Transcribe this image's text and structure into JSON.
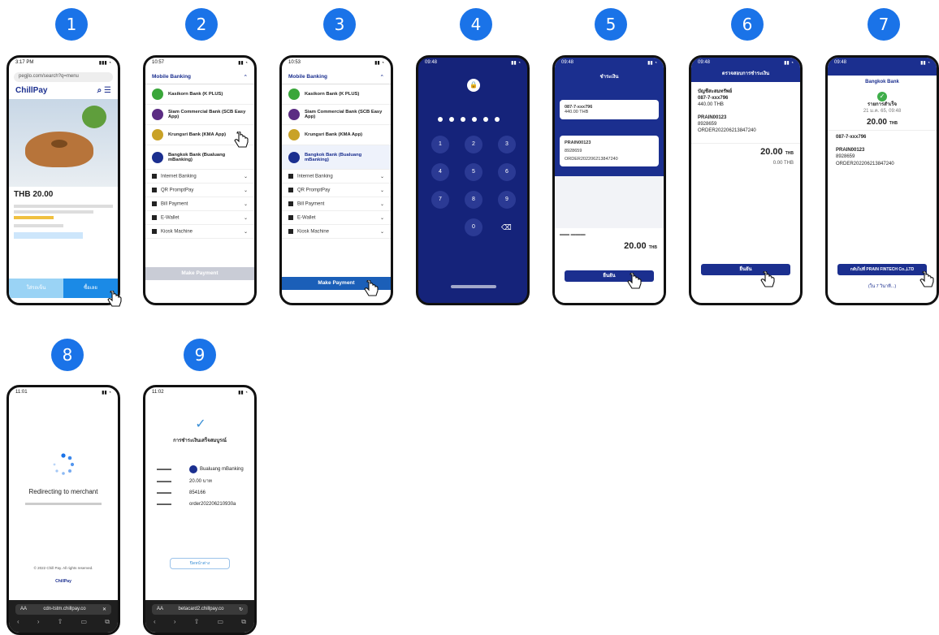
{
  "steps": [
    "1",
    "2",
    "3",
    "4",
    "5",
    "6",
    "7",
    "8",
    "9"
  ],
  "p1": {
    "time": "3:17 PM",
    "url": "pegjlo.com/search?q=menu",
    "logo": "ChillPay",
    "price": "THB 20.00",
    "btn_cart": "ใส่รถเข็น",
    "btn_buy": "ซื้อเลย"
  },
  "p2": {
    "time": "10:57",
    "section": "Mobile Banking",
    "banks": [
      "Kasikorn Bank (K PLUS)",
      "Siam Commercial Bank (SCB Easy App)",
      "Krungsri Bank (KMA App)",
      "Bangkok Bank (Bualuang mBanking)"
    ],
    "cats": [
      "Internet Banking",
      "QR PromptPay",
      "Bill Payment",
      "E-Wallet",
      "Kiosk Machine"
    ],
    "make": "Make Payment"
  },
  "p3": {
    "time": "10:53",
    "section": "Mobile Banking",
    "banks": [
      "Kasikorn Bank (K PLUS)",
      "Siam Commercial Bank (SCB Easy App)",
      "Krungsri Bank (KMA App)",
      "Bangkok Bank (Bualuang mBanking)"
    ],
    "cats": [
      "Internet Banking",
      "QR PromptPay",
      "Bill Payment",
      "E-Wallet",
      "Kiosk Machine"
    ],
    "make": "Make Payment"
  },
  "p4": {
    "time": "09:48",
    "keys": [
      "1",
      "2",
      "3",
      "4",
      "5",
      "6",
      "7",
      "8",
      "9",
      "0"
    ]
  },
  "p5": {
    "time": "09:48",
    "header": "ชำระเงิน",
    "account": "087-7-xxx796",
    "balance": "440.00 THB",
    "to": "PRAIN00123",
    "ref1": "8928659",
    "ref2": "ORDER202206213847240",
    "amount": "20.00",
    "currency": "THB",
    "confirm": "ยืนยัน"
  },
  "p6": {
    "time": "09:48",
    "header": "ตรวจสอบการชำระเงิน",
    "account_name": "บัญชีสะสมทรัพย์",
    "account": "087-7-xxx796",
    "balance": "440.00 THB",
    "to": "PRAIN00123",
    "ref1": "8928659",
    "ref2": "ORDER202206213847240",
    "amount": "20.00",
    "currency": "THB",
    "fee": "0.00 THB",
    "confirm": "ยืนยัน"
  },
  "p7": {
    "time": "09:48",
    "bank": "Bangkok Bank",
    "status": "รายการสำเร็จ",
    "date": "21 ม.ค. 65, 09:48",
    "amount": "20.00",
    "currency": "THB",
    "from": "087-7-xxx796",
    "to": "PRAIN00123",
    "ref": "8928659",
    "ref2": "ORDER202206213847240",
    "return_btn": "กลับไปที่ PRAIN FINTECH Co.,LTD",
    "countdown": "(ใน 7 วินาที...)"
  },
  "p8": {
    "time": "11:01",
    "title": "Redirecting to merchant",
    "copyright": "© 2022 Chill Pay. All rights reserved.",
    "footer_logo": "ChillPay",
    "url": "cdn-tstm.chillpay.co",
    "aa": "AA"
  },
  "p9": {
    "time": "11:02",
    "status_title": "การชำระเงินเสร็จสมบูรณ์",
    "bank_name": "Bualuang mBanking",
    "amount": "20.00 บาท",
    "ref": "854166",
    "order": "order202206210930a",
    "close_btn": "ปิดหน้าต่าง",
    "url": "betacard2.chillpay.co",
    "aa": "AA"
  }
}
